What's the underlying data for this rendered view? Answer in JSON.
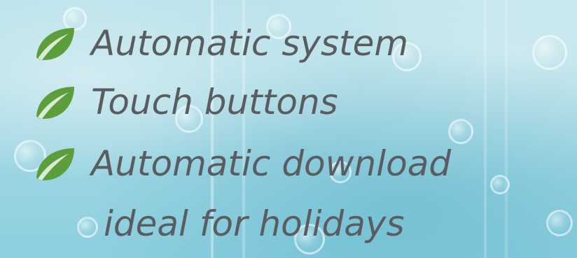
{
  "features": [
    {
      "text": "Automatic system",
      "icon": "leaf-icon"
    },
    {
      "text": "Touch buttons",
      "icon": "leaf-icon"
    },
    {
      "text": "Automatic download",
      "icon": "leaf-icon"
    }
  ],
  "continuation": "ideal for holidays",
  "colors": {
    "text": "#5a5d60",
    "leaf": "#5c9e3c",
    "background": "#a6d9e4"
  }
}
